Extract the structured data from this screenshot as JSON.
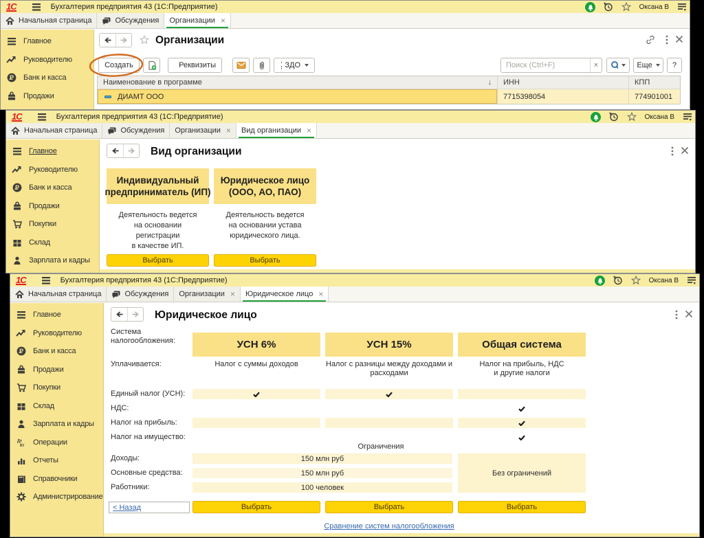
{
  "app": {
    "logo": "1С",
    "title": "Бухгалтерия предприятия 43  (1С:Предприятие)",
    "user": "Оксана В"
  },
  "tabs": {
    "home": "Начальная страница",
    "discussions": "Обсуждения",
    "organizations": "Организации",
    "org_kind": "Вид организации",
    "legal_entity": "Юридическое лицо"
  },
  "sidebar": {
    "items": [
      {
        "label": "Главное",
        "icon": "menu-icon"
      },
      {
        "label": "Руководителю",
        "icon": "trend-icon"
      },
      {
        "label": "Банк и касса",
        "icon": "ruble-icon"
      },
      {
        "label": "Продажи",
        "icon": "bag-icon"
      },
      {
        "label": "Покупки",
        "icon": "cart-icon"
      },
      {
        "label": "Склад",
        "icon": "grid-icon"
      },
      {
        "label": "Зарплата и кадры",
        "icon": "person-icon"
      },
      {
        "label": "Операции",
        "icon": "dtkt-icon"
      },
      {
        "label": "Отчеты",
        "icon": "chart-icon"
      },
      {
        "label": "Справочники",
        "icon": "books-icon"
      },
      {
        "label": "Администрирование",
        "icon": "gear-icon"
      }
    ]
  },
  "w1": {
    "page_title": "Организации",
    "toolbar": {
      "create": "Создать",
      "requisites": "Реквизиты",
      "zdo": "ЗДО",
      "search_placeholder": "Поиск (Ctrl+F)",
      "search_clear": "×",
      "more": "Еще",
      "help": "?"
    },
    "table": {
      "columns": [
        "Наименование в программе",
        "ИНН",
        "КПП"
      ],
      "sort_indicator": "↓",
      "rows": [
        {
          "name": "ДИАМТ ООО",
          "inn": "7715398054",
          "kpp": "774901001"
        }
      ]
    },
    "annotation_color": "#d2691e"
  },
  "w2": {
    "page_title": "Вид организации",
    "cards": [
      {
        "title_line1": "Индивидуальный",
        "title_line2": "предприниматель (ИП)",
        "desc_lines": [
          "Деятельность ведется",
          "на основании",
          "регистрации",
          "в качестве ИП."
        ],
        "button": "Выбрать"
      },
      {
        "title_line1": "Юридическое лицо",
        "title_line2": "(ООО, АО, ПАО)",
        "desc_lines": [
          "Деятельность ведется",
          "на основании устава",
          "юридического лица."
        ],
        "button": "Выбрать"
      }
    ]
  },
  "w3": {
    "page_title": "Юридическое лицо",
    "row_labels": {
      "system": [
        "Система",
        "налогообложения:"
      ],
      "pays": "Уплачивается:",
      "usn": "Единый налог (УСН):",
      "nds": "НДС:",
      "profit": "Налог на прибыль:",
      "property": "Налог на имущество:"
    },
    "columns": [
      {
        "name": "УСН 6%",
        "pays1": "Налог с суммы доходов",
        "pays2": "",
        "checks": [
          "usn"
        ]
      },
      {
        "name": "УСН 15%",
        "pays1": "Налог с разницы между доходами и",
        "pays2": "расходами",
        "checks": [
          "usn"
        ]
      },
      {
        "name": "Общая система",
        "pays1": "Налог на прибыль, НДС",
        "pays2": "и другие налоги",
        "checks": [
          "nds",
          "profit",
          "property"
        ]
      }
    ],
    "limits": {
      "heading": "Ограничения",
      "rows": [
        {
          "label": "Доходы:",
          "value": "150 млн руб"
        },
        {
          "label": "Основные средства:",
          "value": "150 млн руб"
        },
        {
          "label": "Работники:",
          "value": "100 человек"
        }
      ],
      "unlimited": "Без ограничений"
    },
    "back_link": "< Назад",
    "select_button": "Выбрать",
    "compare_link": "Сравнение систем налогообложения"
  },
  "colors": {
    "titlebar": "#f8eca1",
    "sidebar": "#f7e591",
    "card_yellow": "#fae187",
    "pale_row": "#fdf4d3",
    "button_yellow": "#fed305",
    "active_tab_underline": "#21a038",
    "link_blue": "#3767ac",
    "annotation_orange": "#d2691e",
    "logo_red": "#e31e24",
    "notification_green": "#17a13c",
    "selected_cell": "#fbde76"
  }
}
